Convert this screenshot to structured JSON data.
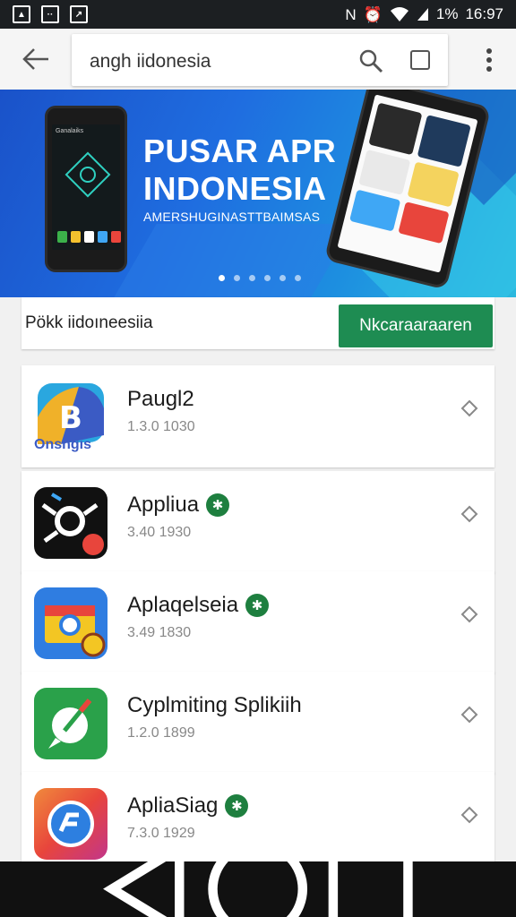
{
  "status_bar": {
    "battery_text": "1%",
    "time": "16:97",
    "icons": [
      "gallery-icon",
      "message-icon",
      "chart-icon",
      "nfc-icon",
      "alarm-icon",
      "wifi-icon",
      "signal-icon"
    ]
  },
  "top_bar": {
    "search_text": "angh iidonesia"
  },
  "banner": {
    "title_line1": "PUSAR APR",
    "title_line2": "INDONESIA",
    "subtitle": "AMERSHUGINASTTBAIMSAS",
    "phone_text": "Ganalaiks",
    "slides": 6,
    "active_slide": 0
  },
  "search_row": {
    "query": "Pökk iidoıneesiia",
    "button_label": "Nkcaraaraaren"
  },
  "apps": [
    {
      "name": "Paugl2",
      "meta": "1.3.0 1030",
      "verified": false
    },
    {
      "name": "Appliua",
      "meta": "3.40 1930",
      "verified": true
    },
    {
      "name": "Aplaqelseia",
      "meta": "3.49 1830",
      "verified": true
    },
    {
      "name": "Cyplmiting Splikiih",
      "meta": "1.2.0 1899",
      "verified": false
    },
    {
      "name": "ApliaSiag",
      "meta": "7.3.0 1929",
      "verified": true
    }
  ],
  "first_icon_text": "Onsngis",
  "colors": {
    "accent_green": "#1e8c52",
    "status_bar": "#1c1f22",
    "banner_blue": "#1f6de0",
    "nav_bar": "#111111"
  }
}
